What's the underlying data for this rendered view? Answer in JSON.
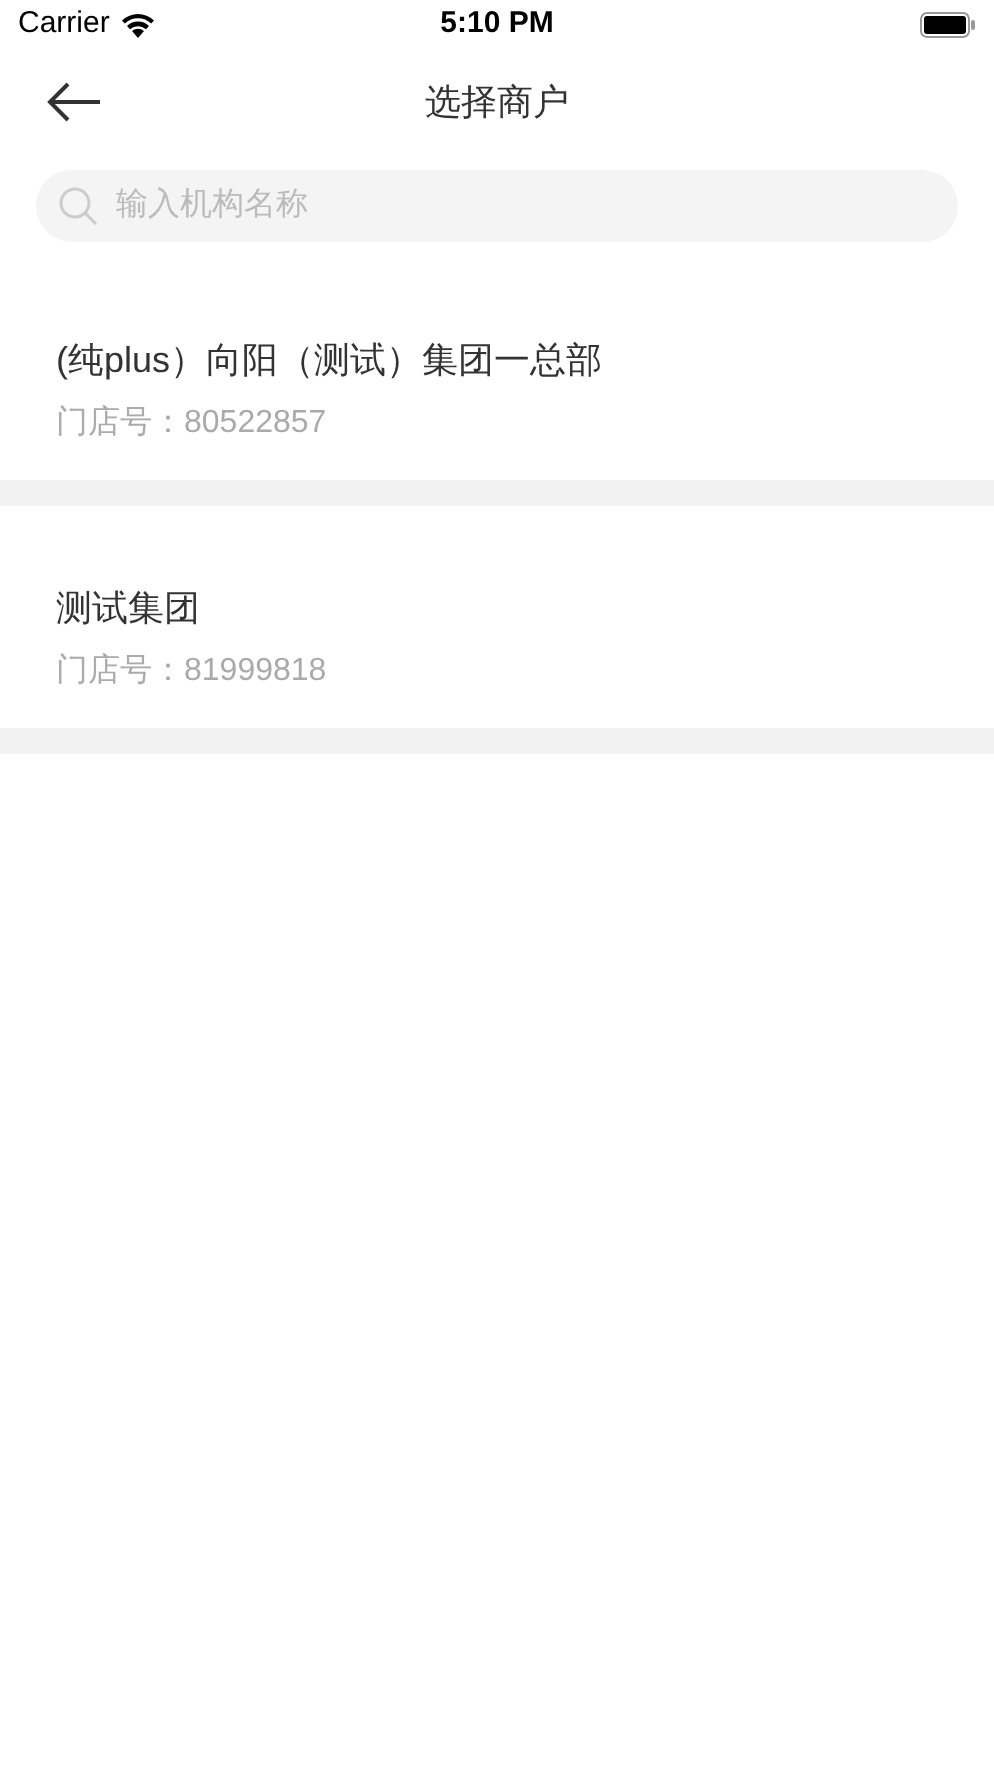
{
  "status_bar": {
    "carrier": "Carrier",
    "time": "5:10 PM"
  },
  "nav": {
    "title": "选择商户"
  },
  "search": {
    "placeholder": "输入机构名称"
  },
  "merchants": [
    {
      "name": "(纯plus）向阳（测试）集团一总部",
      "store": "门店号：80522857"
    },
    {
      "name": "测试集团",
      "store": "门店号：81999818"
    }
  ]
}
